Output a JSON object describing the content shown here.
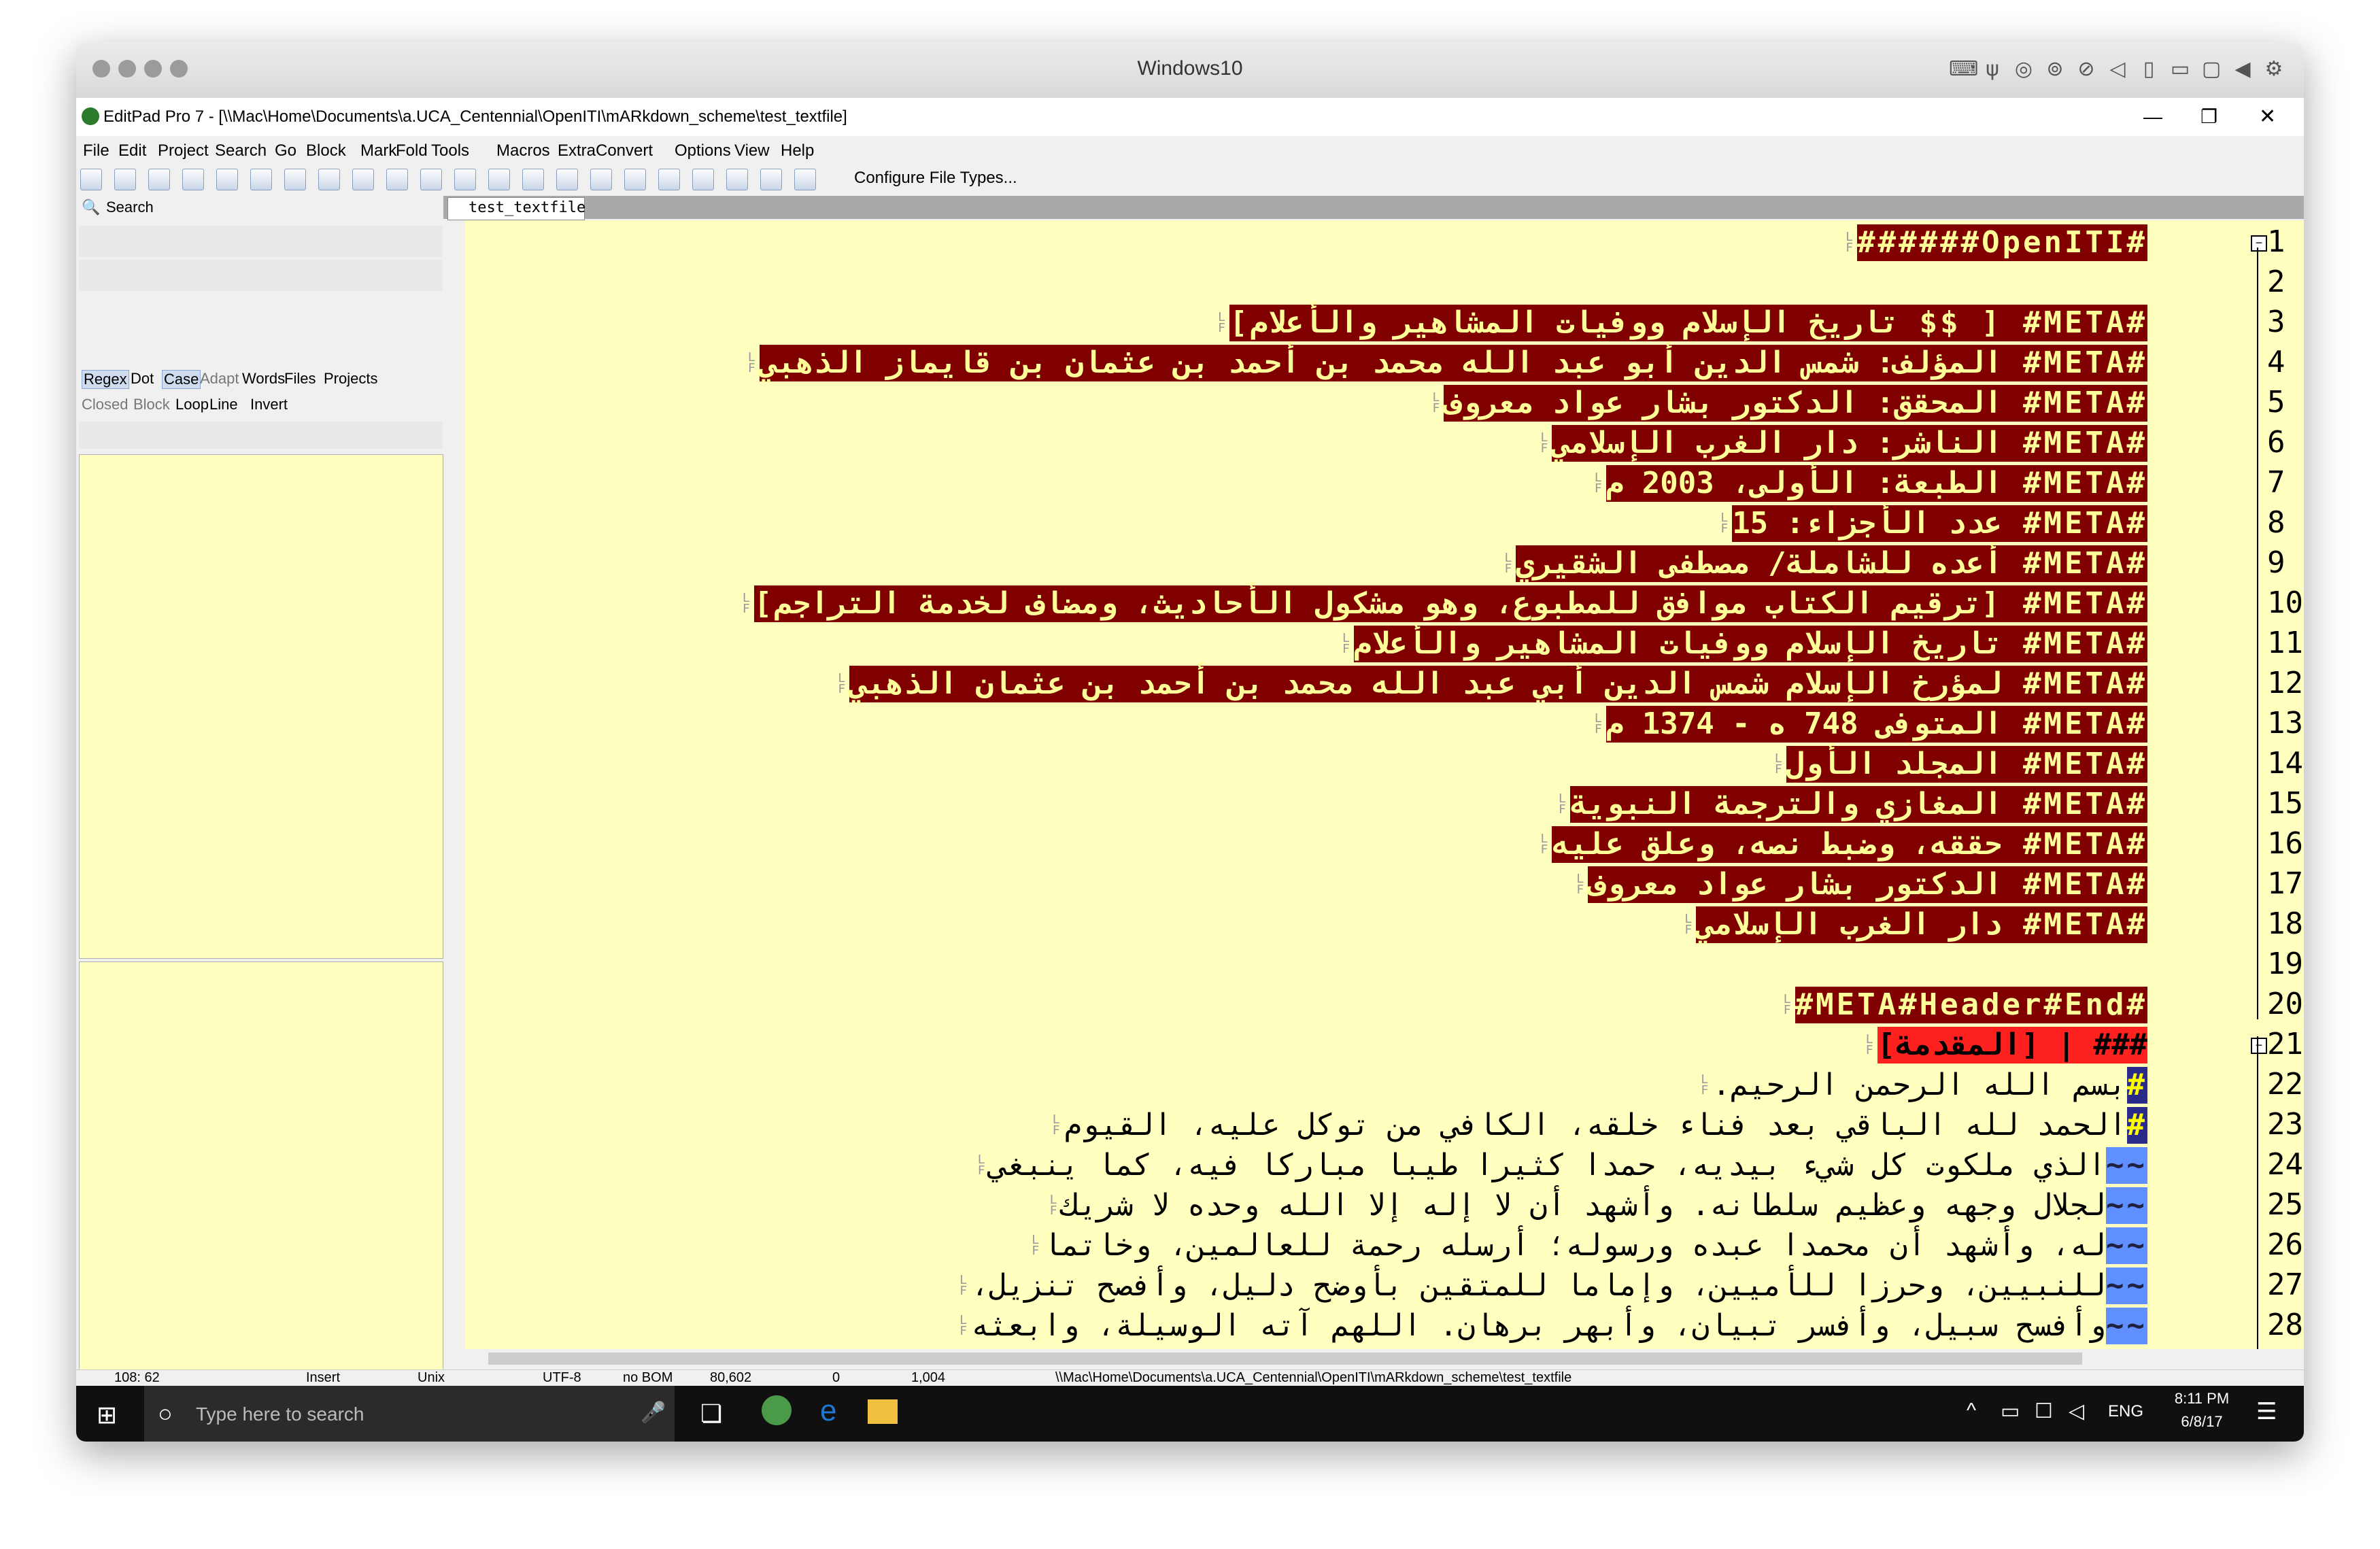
{
  "mac": {
    "title": "Windows10"
  },
  "app": {
    "title": "EditPad Pro 7 - [\\\\Mac\\Home\\Documents\\a.UCA_Centennial\\OpenITI\\mARkdown_scheme\\test_textfile]",
    "menu": [
      "File",
      "Edit",
      "Project",
      "Search",
      "Go",
      "Block",
      "Mark",
      "Fold",
      "Tools",
      "Macros",
      "Extra",
      "Convert",
      "Options",
      "View",
      "Help"
    ],
    "toolbar_label": "Configure File Types...",
    "search_title": "Search",
    "search_options_row1": [
      "Regex",
      "Dot",
      "Case",
      "Adapt",
      "Words",
      "Files",
      "Projects"
    ],
    "search_options_row2": [
      "Closed",
      "Block",
      "Loop",
      "Line",
      "Invert"
    ],
    "tab": "test_textfile"
  },
  "editor": {
    "lines": [
      {
        "n": "1",
        "type": "meta",
        "text": "#OpenITI######"
      },
      {
        "n": "2",
        "type": "empty",
        "text": ""
      },
      {
        "n": "3",
        "type": "meta",
        "text": "#META# [ $$ تاريخ الإسلام ووفيات المشاهير والأعلام]"
      },
      {
        "n": "4",
        "type": "meta",
        "text": "#META# المؤلف: شمس الدين أبو عبد الله محمد بن أحمد بن عثمان بن قايماز الذهبي"
      },
      {
        "n": "5",
        "type": "meta",
        "text": "#META# المحقق: الدكتور بشار عواد معروف"
      },
      {
        "n": "6",
        "type": "meta",
        "text": "#META# الناشر: دار الغرب الإسلامي"
      },
      {
        "n": "7",
        "type": "meta",
        "text": "#META# الطبعة: الأولى، 2003 م"
      },
      {
        "n": "8",
        "type": "meta",
        "text": "#META# عدد الأجزاء: 15"
      },
      {
        "n": "9",
        "type": "meta",
        "text": "#META# أعده للشاملة/ مصطفى الشقيري"
      },
      {
        "n": "10",
        "type": "meta",
        "text": "#META# [ترقيم الكتاب موافق للمطبوع، وهو مشكول الأحاديث، ومضاف لخدمة التراجم]"
      },
      {
        "n": "11",
        "type": "meta",
        "text": "#META# تاريخ الإسلام ووفيات المشاهير والأعلام"
      },
      {
        "n": "12",
        "type": "meta",
        "text": "#META# لمؤرخ الإسلام شمس الدين أبي عبد الله محمد بن أحمد بن عثمان الذهبي"
      },
      {
        "n": "13",
        "type": "meta",
        "text": "#META# المتوفى 748 ه - 1374 م"
      },
      {
        "n": "14",
        "type": "meta",
        "text": "#META# المجلد الأول"
      },
      {
        "n": "15",
        "type": "meta",
        "text": "#META# المغازي والترجمة النبوية"
      },
      {
        "n": "16",
        "type": "meta",
        "text": "#META# حققه، وضبط نصه، وعلق عليه"
      },
      {
        "n": "17",
        "type": "meta",
        "text": "#META# الدكتور بشار عواد معروف"
      },
      {
        "n": "18",
        "type": "meta",
        "text": "#META# دار الغرب الإسلامي"
      },
      {
        "n": "19",
        "type": "empty",
        "text": ""
      },
      {
        "n": "20",
        "type": "meta",
        "text": "#META#Header#End#"
      },
      {
        "n": "21",
        "type": "header",
        "text": "### | [المقدمة]"
      },
      {
        "n": "22",
        "type": "hash",
        "text": "بسم الله الرحمن الرحيم."
      },
      {
        "n": "23",
        "type": "hash",
        "text": "الحمد لله الباقي بعد فناء خلقه، الكافي من توكل عليه، القيوم"
      },
      {
        "n": "24",
        "type": "tilde",
        "text": "الذي ملكوت كل شيء بيديه، حمدا كثيرا طيبا مباركا فيه، كما ينبغي"
      },
      {
        "n": "25",
        "type": "tilde",
        "text": "لجلال وجهه وعظيم سلطانه. وأشهد أن لا إله إلا الله وحده لا شريك"
      },
      {
        "n": "26",
        "type": "tilde",
        "text": "له، وأشهد أن محمدا عبده ورسوله؛ أرسله رحمة للعالمين، وخاتما"
      },
      {
        "n": "27",
        "type": "tilde",
        "text": "للنبيين، وحرزا للأميين، وإماما للمتقين بأوضح دليل، وأفصح تنزيل،"
      },
      {
        "n": "28",
        "type": "tilde",
        "text": "وأفسح سبيل، وأفسر تبيان، وأبهر برهان. اللهم آته الوسيلة، وابعثه"
      }
    ]
  },
  "status": [
    "108: 62",
    "Insert",
    "Unix",
    "UTF-8",
    "no BOM",
    "80,602",
    "0",
    "1,004",
    "\\\\Mac\\Home\\Documents\\a.UCA_Centennial\\OpenITI\\mARkdown_scheme\\test_textfile"
  ],
  "taskbar": {
    "search_placeholder": "Type here to search",
    "lang": "ENG",
    "time": "8:11 PM",
    "date": "6/8/17"
  }
}
